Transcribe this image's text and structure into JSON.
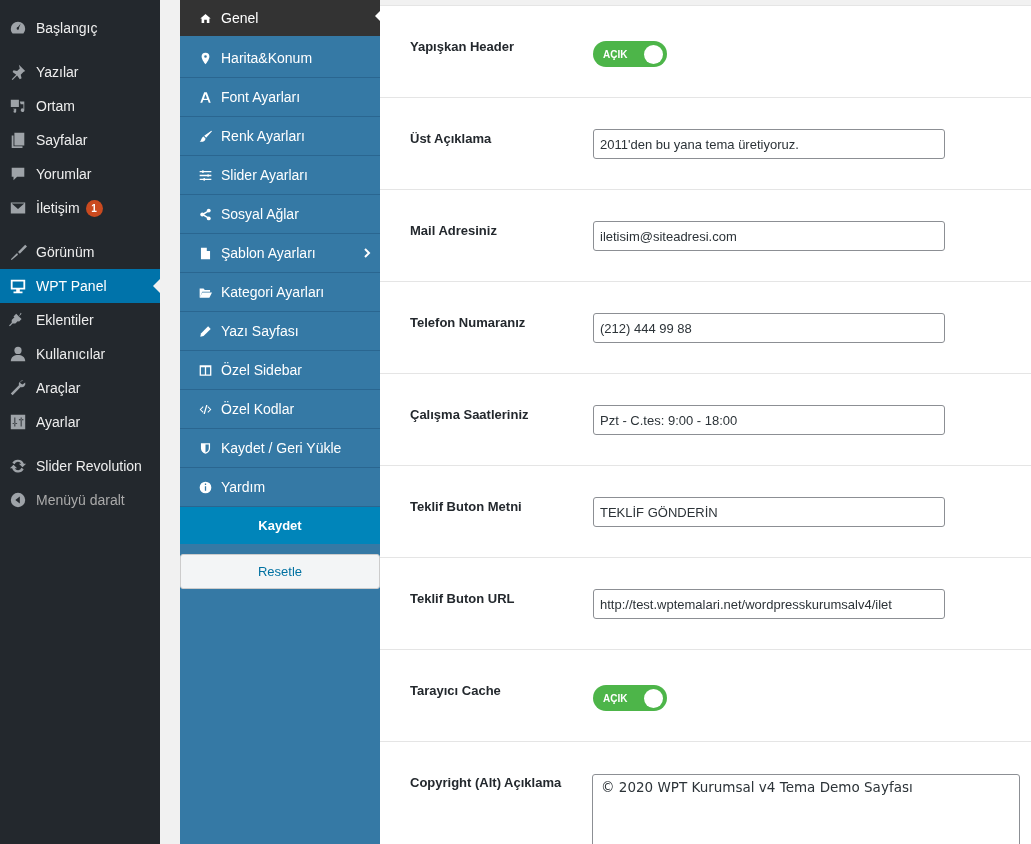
{
  "admin_menu": [
    {
      "label": "Başlangıç",
      "selected": false,
      "separator_after": true
    },
    {
      "label": "Yazılar",
      "selected": false
    },
    {
      "label": "Ortam",
      "selected": false
    },
    {
      "label": "Sayfalar",
      "selected": false
    },
    {
      "label": "Yorumlar",
      "selected": false
    },
    {
      "label": "İletişim",
      "selected": false,
      "badge": "1",
      "separator_after": true
    },
    {
      "label": "Görünüm",
      "selected": false
    },
    {
      "label": "WPT Panel",
      "selected": true
    },
    {
      "label": "Eklentiler",
      "selected": false
    },
    {
      "label": "Kullanıcılar",
      "selected": false
    },
    {
      "label": "Araçlar",
      "selected": false
    },
    {
      "label": "Ayarlar",
      "selected": false,
      "separator_after": true
    },
    {
      "label": "Slider Revolution",
      "selected": false
    },
    {
      "label": "Menüyü daralt",
      "selected": false,
      "kind": "collapse"
    }
  ],
  "panel_menu": [
    {
      "label": "Genel",
      "selected": true
    },
    {
      "label": "Harita&Konum",
      "selected": false
    },
    {
      "label": "Font Ayarları",
      "selected": false
    },
    {
      "label": "Renk Ayarları",
      "selected": false
    },
    {
      "label": "Slider Ayarları",
      "selected": false
    },
    {
      "label": "Sosyal Ağlar",
      "selected": false
    },
    {
      "label": "Şablon Ayarları",
      "selected": false,
      "has_submenu": true
    },
    {
      "label": "Kategori Ayarları",
      "selected": false
    },
    {
      "label": "Yazı Sayfası",
      "selected": false
    },
    {
      "label": "Özel Sidebar",
      "selected": false
    },
    {
      "label": "Özel Kodlar",
      "selected": false
    },
    {
      "label": "Kaydet / Geri Yükle",
      "selected": false
    },
    {
      "label": "Yardım",
      "selected": false
    }
  ],
  "save_button": "Kaydet",
  "reset_button": "Resetle",
  "settings": [
    {
      "kind": "toggle",
      "label": "Yapışkan Header",
      "on": true,
      "toggle_text": "AÇIK"
    },
    {
      "kind": "input",
      "label": "Üst Açıklama",
      "value": "2011'den bu yana tema üretiyoruz."
    },
    {
      "kind": "input",
      "label": "Mail Adresiniz",
      "value": "iletisim@siteadresi.com"
    },
    {
      "kind": "input",
      "label": "Telefon Numaranız",
      "value": "(212) 444 99 88"
    },
    {
      "kind": "input",
      "label": "Çalışma Saatleriniz",
      "value": "Pzt - C.tes: 9:00 - 18:00"
    },
    {
      "kind": "input",
      "label": "Teklif Buton Metni",
      "value": "TEKLİF GÖNDERİN"
    },
    {
      "kind": "input",
      "label": "Teklif Buton URL",
      "value": "http://test.wptemalari.net/wordpresskurumsalv4/ilet"
    },
    {
      "kind": "toggle",
      "label": "Tarayıcı Cache",
      "on": true,
      "toggle_text": "AÇIK"
    },
    {
      "kind": "textarea",
      "label": "Copyright (Alt) Açıklama",
      "value": "© 2020 WPT Kurumsal v4 Tema Demo Sayfası"
    }
  ]
}
